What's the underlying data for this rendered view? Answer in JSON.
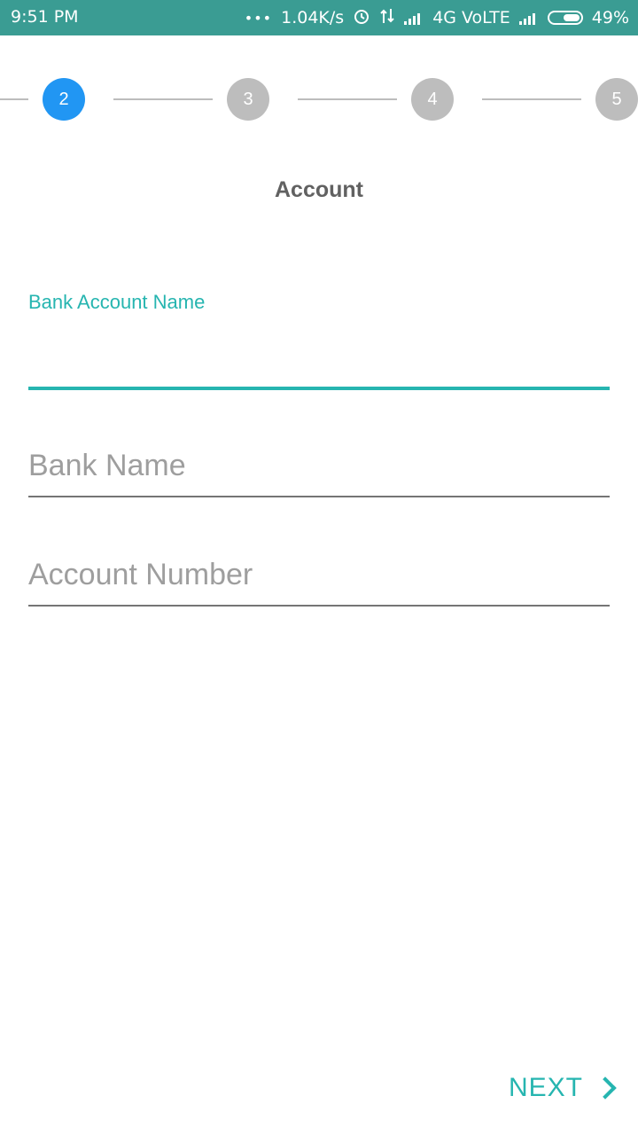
{
  "status_bar": {
    "time": "9:51 PM",
    "dots": "•••",
    "speed": "1.04K/s",
    "network": "4G VoLTE",
    "battery": "49%",
    "icons": [
      "alarm-icon",
      "data-transfer-icon",
      "signal-icon",
      "battery-icon"
    ]
  },
  "stepper": {
    "steps": [
      {
        "label": "2",
        "state": "active"
      },
      {
        "label": "3",
        "state": "inactive"
      },
      {
        "label": "4",
        "state": "inactive"
      },
      {
        "label": "5",
        "state": "inactive"
      }
    ]
  },
  "form": {
    "title": "Account",
    "fields": [
      {
        "label": "Bank Account Name",
        "value": "",
        "focused": true
      },
      {
        "placeholder": "Bank Name",
        "value": ""
      },
      {
        "placeholder": "Account Number",
        "value": ""
      }
    ]
  },
  "footer": {
    "next_label": "NEXT",
    "next_icon": "chevron-right-icon"
  },
  "colors": {
    "status_bar": "#3a9c93",
    "accent": "#26b5b0",
    "active_step": "#2196f3",
    "inactive_step": "#bdbdbd"
  }
}
